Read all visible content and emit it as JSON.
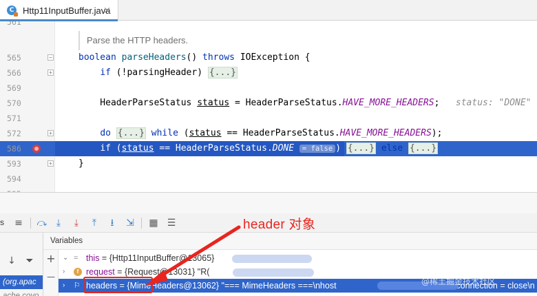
{
  "tab": {
    "title": "Http11InputBuffer.java",
    "close": "×",
    "icon": "java-class-icon"
  },
  "editor": {
    "doc_comment": "Parse the HTTP headers.",
    "lines": [
      {
        "number": "561",
        "tokens": []
      },
      {
        "number": "565",
        "tokens": [
          [
            "kw",
            "boolean "
          ],
          [
            "fn",
            "parseHeaders"
          ],
          [
            "t",
            "() "
          ],
          [
            "kw",
            "throws "
          ],
          [
            "t",
            "IOException {"
          ]
        ]
      },
      {
        "number": "566",
        "tokens": [
          [
            "t",
            "    "
          ],
          [
            "kw",
            "if "
          ],
          [
            "t",
            "(!parsingHeader) "
          ],
          [
            "fold",
            "{...}"
          ]
        ]
      },
      {
        "number": "569",
        "tokens": []
      },
      {
        "number": "570",
        "tokens": [
          [
            "t",
            "    HeaderParseStatus "
          ],
          [
            "ul",
            "status"
          ],
          [
            "t",
            " = HeaderParseStatus."
          ],
          [
            "it",
            "HAVE_MORE_HEADERS"
          ],
          [
            "t",
            ";   "
          ],
          [
            "hint",
            "status: \"DONE\""
          ]
        ]
      },
      {
        "number": "571",
        "tokens": []
      },
      {
        "number": "572",
        "tokens": [
          [
            "t",
            "    "
          ],
          [
            "kw",
            "do "
          ],
          [
            "fold",
            "{...}"
          ],
          [
            "t",
            " "
          ],
          [
            "kw",
            "while "
          ],
          [
            "t",
            "("
          ],
          [
            "ul",
            "status"
          ],
          [
            "t",
            " == HeaderParseStatus."
          ],
          [
            "it",
            "HAVE_MORE_HEADERS"
          ],
          [
            "t",
            ");"
          ]
        ]
      },
      {
        "number": "586",
        "tokens": [
          [
            "t",
            "    "
          ],
          [
            "kw",
            "if "
          ],
          [
            "t",
            "("
          ],
          [
            "ul",
            "status"
          ],
          [
            "t",
            " == HeaderParseStatus."
          ],
          [
            "it",
            "DONE"
          ],
          [
            "t",
            " "
          ],
          [
            "badge",
            "= false"
          ],
          [
            "t",
            ") "
          ],
          [
            "fold",
            "{...}"
          ],
          [
            "t",
            " "
          ],
          [
            "kw",
            "else "
          ],
          [
            "fold",
            "{...}"
          ]
        ]
      },
      {
        "number": "593",
        "tokens": [
          [
            "t",
            "}"
          ]
        ]
      },
      {
        "number": "594",
        "tokens": []
      },
      {
        "number": "595",
        "tokens": []
      }
    ]
  },
  "debug": {
    "toolbar_text": "s",
    "variables_title": "Variables",
    "frames": [
      {
        "label": "(org.apac",
        "selected": true
      },
      {
        "label": "ache.coyo",
        "selected": false
      }
    ],
    "variables": [
      {
        "name": "this",
        "value": " = {Http11InputBuffer@13065}",
        "icon": "equals-icon",
        "expanded": true
      },
      {
        "name": "request",
        "value": " = {Request@13031} \"R(",
        "icon": "field-icon",
        "expanded": false
      },
      {
        "name": "headers",
        "value": " = {MimeHeaders@13062} \"=== MimeHeaders ===\\nhost",
        "value_tail": "\\nconnection = close\\n",
        "icon": "flag-icon",
        "expanded": false,
        "selected": true
      }
    ]
  },
  "annotation": {
    "label": "header 对象",
    "color": "#e8251f"
  },
  "watermark": "@稀土掘金技术社区"
}
